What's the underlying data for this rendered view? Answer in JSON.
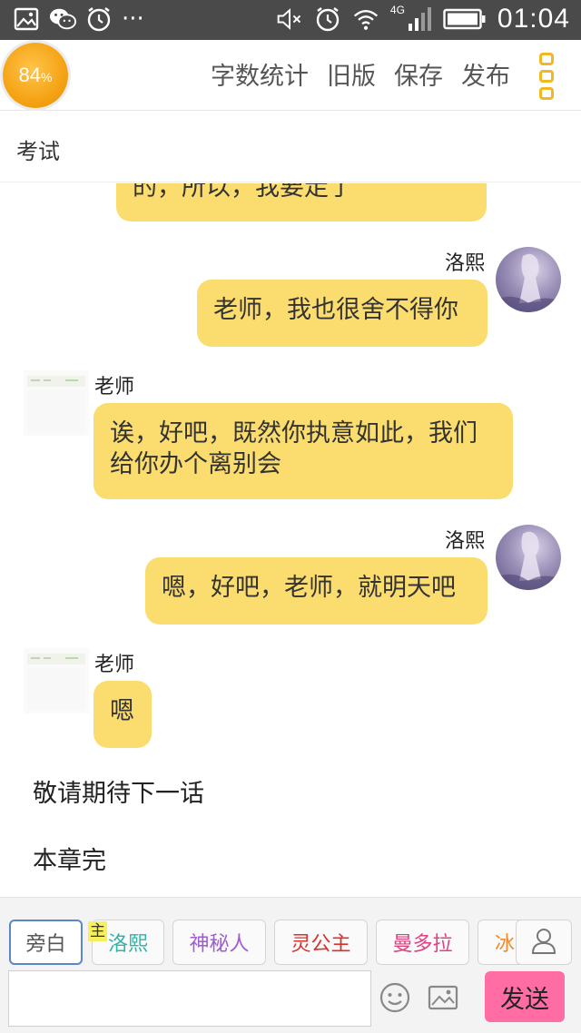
{
  "status_bar": {
    "time": "01:04",
    "network_label": "4G",
    "left_icons": [
      "image-icon",
      "wechat-icon",
      "alarm-icon",
      "more-dots-icon"
    ],
    "right_icons": [
      "mute-icon",
      "alarm-icon",
      "wifi-icon",
      "signal-icon",
      "battery-icon"
    ],
    "more_dots": "···"
  },
  "toolbar": {
    "progress_percent": 84,
    "progress_value": "84",
    "progress_unit": "%",
    "word_count_label": "字数统计",
    "old_version_label": "旧版",
    "save_label": "保存",
    "publish_label": "发布"
  },
  "chapter": {
    "title": "考试"
  },
  "messages": [
    {
      "side": "left",
      "speaker": "",
      "text": "的，所以，我要走了",
      "partial": true
    },
    {
      "side": "right",
      "speaker": "洛熙",
      "text": "老师，我也很舍不得你"
    },
    {
      "side": "left",
      "speaker": "老师",
      "text_line1": "诶，好吧，既然你执意如此，我们",
      "text_line2": "给你办个离别会"
    },
    {
      "side": "right",
      "speaker": "洛熙",
      "text": "嗯，好吧，老师，就明天吧"
    },
    {
      "side": "left",
      "speaker": "老师",
      "text": "嗯"
    }
  ],
  "narration": [
    "敬请期待下一话",
    "本章完"
  ],
  "role_chips": [
    {
      "label": "旁白",
      "color": "#555555",
      "active": true
    },
    {
      "label": "洛熙",
      "color": "#2fb5a8",
      "badge": "主"
    },
    {
      "label": "神秘人",
      "color": "#a05ccf"
    },
    {
      "label": "灵公主",
      "color": "#d6332f"
    },
    {
      "label": "曼多拉",
      "color": "#e0417f"
    },
    {
      "label": "冰",
      "color": "#f08a2a"
    }
  ],
  "input": {
    "value": "",
    "placeholder": ""
  },
  "send_label": "发送",
  "colors": {
    "bubble": "#fbdc6e",
    "send_button": "#ff6da4",
    "progress": "#f5a315",
    "menu_icon": "#f2b721"
  }
}
